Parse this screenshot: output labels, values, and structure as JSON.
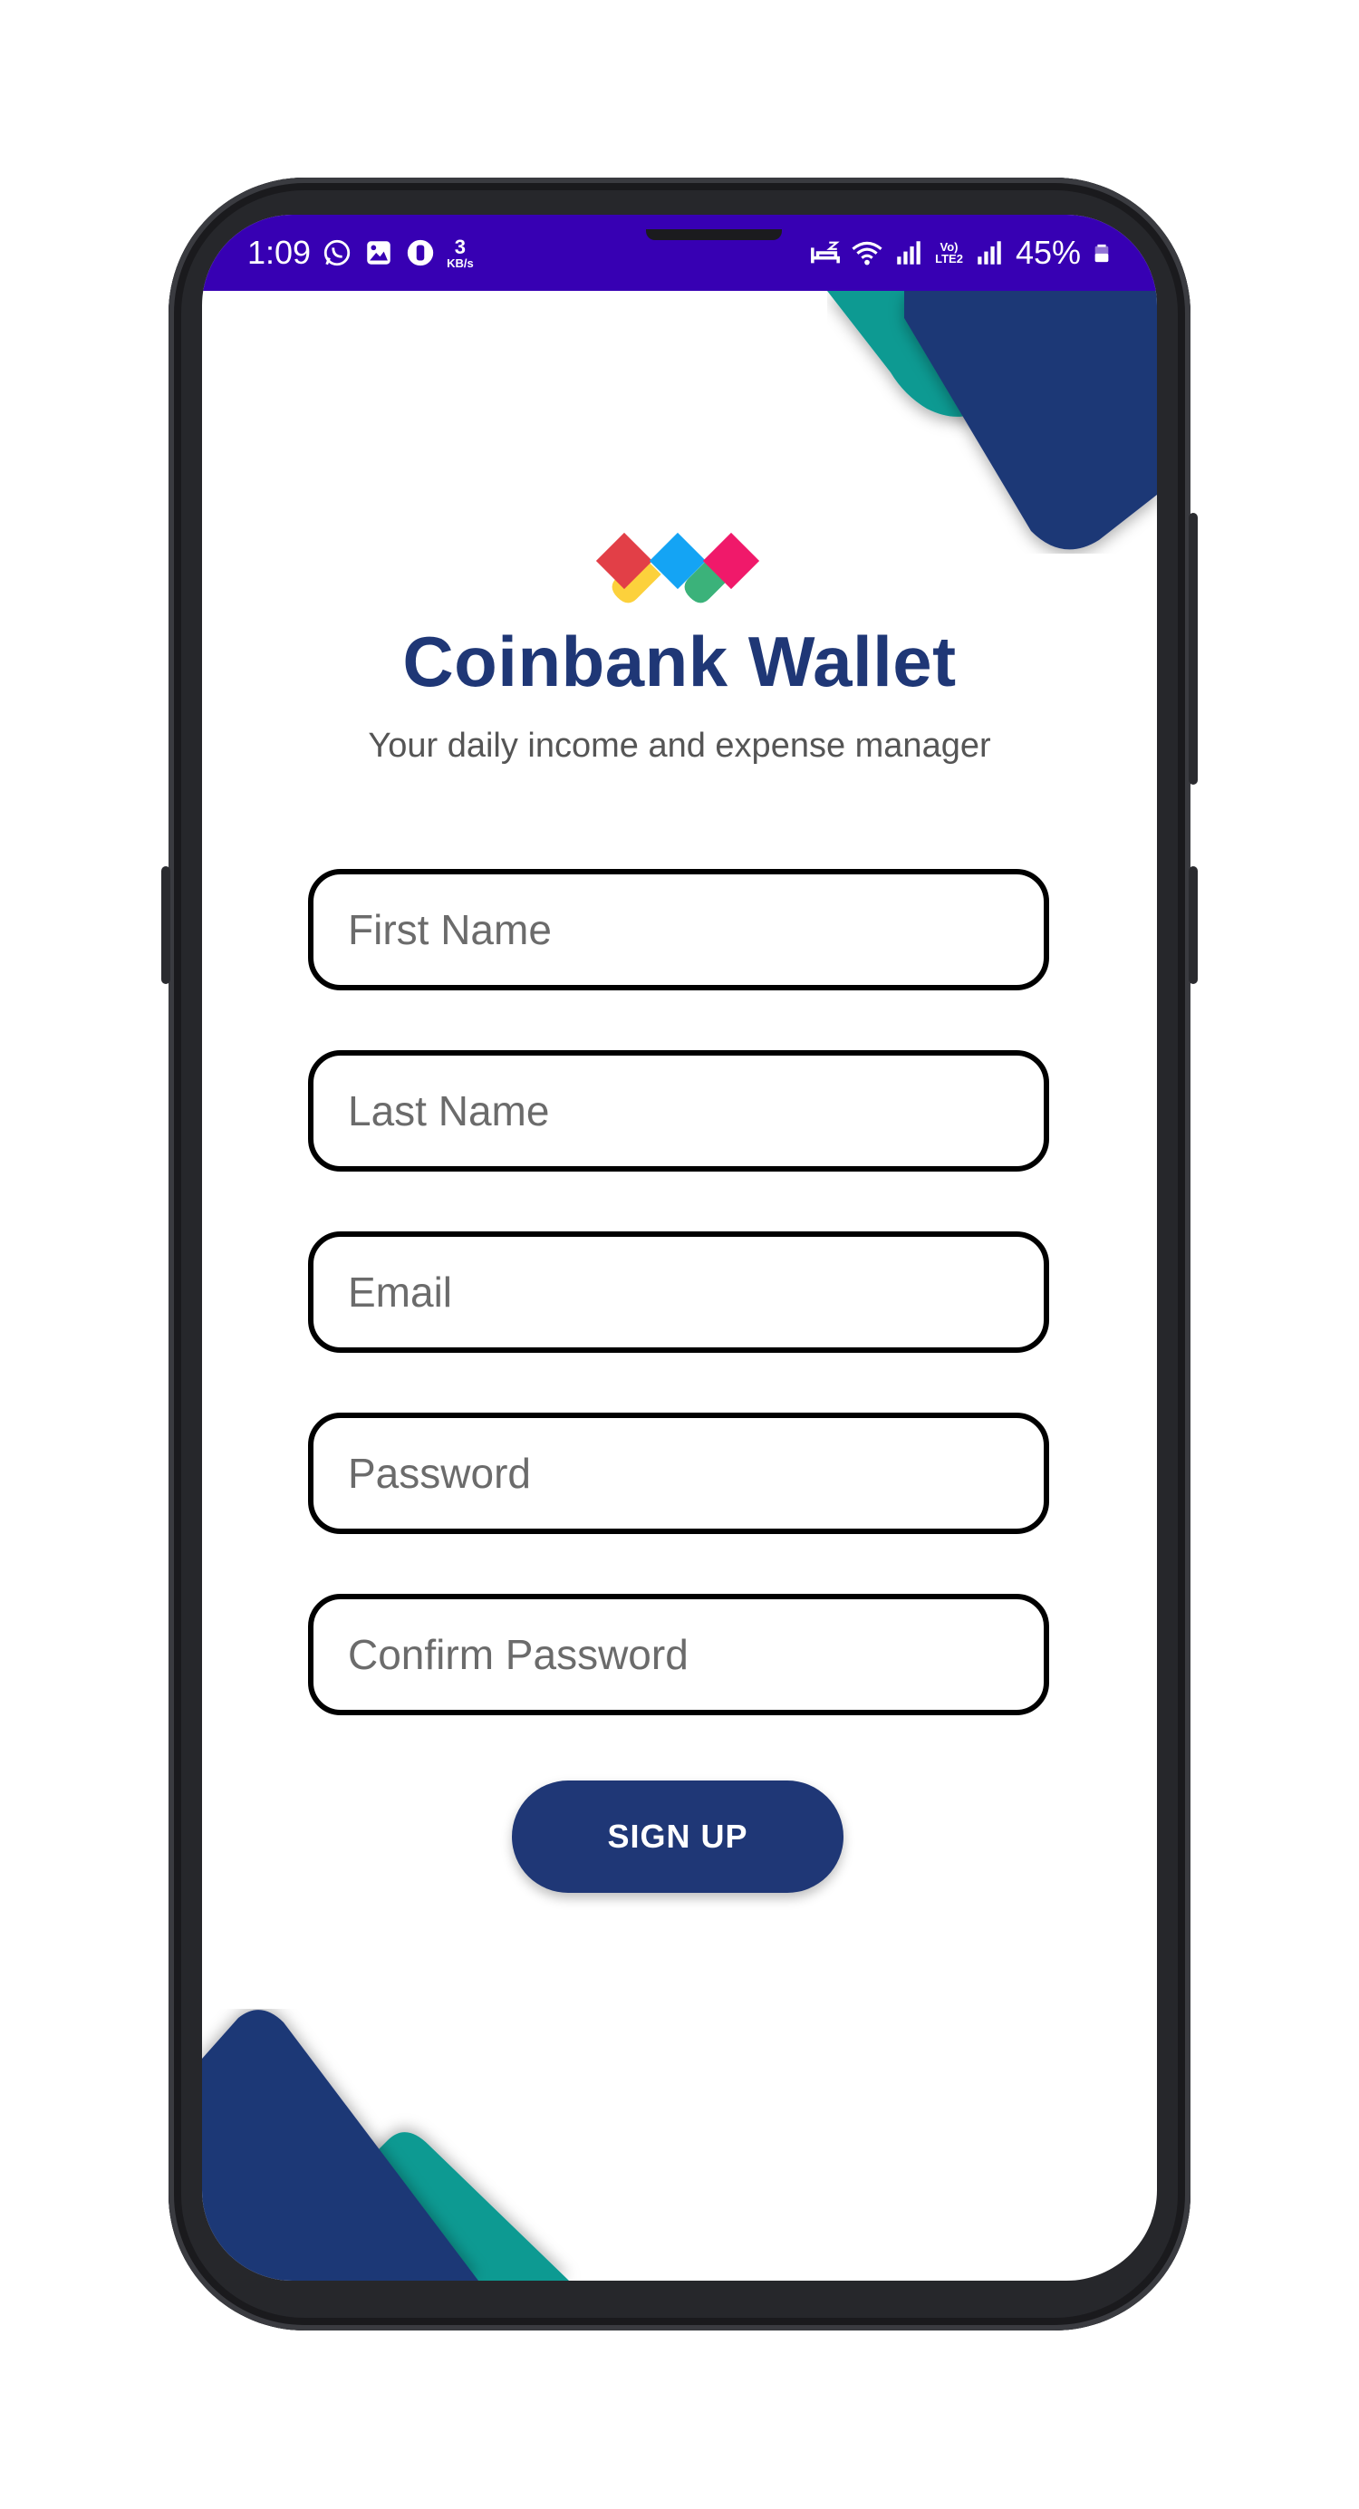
{
  "status_bar": {
    "time": "1:09",
    "net_speed_value": "3",
    "net_speed_unit": "KB/s",
    "volte_top": "Vo)",
    "volte_bottom": "LTE2",
    "battery": "45%"
  },
  "app": {
    "title": "Coinbank Wallet",
    "subtitle": "Your daily income and expense manager",
    "logo_colors": [
      "#e23f47",
      "#fcd13c",
      "#14a4f4",
      "#3bb27a",
      "#f0196a"
    ]
  },
  "form": {
    "first_name_placeholder": "First Name",
    "last_name_placeholder": "Last Name",
    "email_placeholder": "Email",
    "password_placeholder": "Password",
    "confirm_password_placeholder": "Confirm Password",
    "signup_label": "SIGN UP"
  },
  "colors": {
    "status_bar": "#3700b3",
    "primary": "#1f3776",
    "accent": "#0e9a92"
  }
}
